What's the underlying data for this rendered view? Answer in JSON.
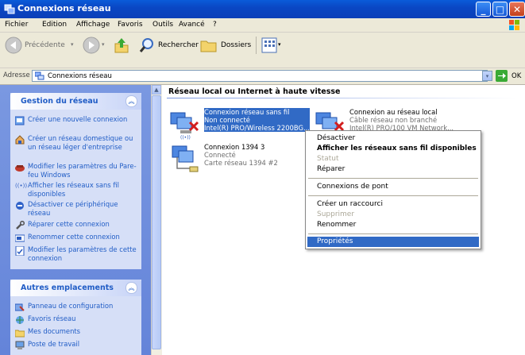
{
  "window": {
    "title": "Connexions réseau"
  },
  "menu": [
    "Fichier",
    "Edition",
    "Affichage",
    "Favoris",
    "Outils",
    "Avancé",
    "?"
  ],
  "toolbar": {
    "back": "Précédente",
    "search": "Rechercher",
    "folders": "Dossiers"
  },
  "address": {
    "label": "Adresse",
    "value": "Connexions réseau",
    "go": "OK"
  },
  "left_panes": [
    {
      "title": "Gestion du réseau",
      "tasks": [
        {
          "icon": "create-connection-icon",
          "label": "Créer une nouvelle connexion"
        },
        {
          "icon": "home-network-icon",
          "label": "Créer un réseau domestique ou un réseau léger d'entreprise"
        },
        {
          "icon": "firewall-icon",
          "label": "Modifier les paramètres du Pare-feu Windows"
        },
        {
          "icon": "wireless-icon",
          "label": "Afficher les réseaux sans fil disponibles"
        },
        {
          "icon": "disable-device-icon",
          "label": "Désactiver ce périphérique réseau"
        },
        {
          "icon": "repair-icon",
          "label": "Réparer cette connexion"
        },
        {
          "icon": "rename-icon",
          "label": "Renommer cette connexion"
        },
        {
          "icon": "properties-icon",
          "label": "Modifier les paramètres de cette connexion"
        }
      ]
    },
    {
      "title": "Autres emplacements",
      "tasks": [
        {
          "icon": "control-panel-icon",
          "label": "Panneau de configuration"
        },
        {
          "icon": "network-places-icon",
          "label": "Favoris réseau"
        },
        {
          "icon": "my-documents-icon",
          "label": "Mes documents"
        },
        {
          "icon": "my-computer-icon",
          "label": "Poste de travail"
        }
      ]
    }
  ],
  "group_header": "Réseau local ou Internet à haute vitesse",
  "connections": [
    {
      "name": "Connexion réseau sans fil",
      "status": "Non connecté",
      "device": "Intel(R) PRO/Wireless 2200BG..."
    },
    {
      "name": "Connexion au réseau local",
      "status": "Câble réseau non branché",
      "device": "Intel(R) PRO/100 VM Network..."
    },
    {
      "name": "Connexion 1394 3",
      "status": "Connecté",
      "device": "Carte réseau 1394 #2"
    }
  ],
  "context_menu": [
    {
      "label": "Désactiver",
      "state": "normal"
    },
    {
      "label": "Afficher les réseaux sans fil disponibles",
      "state": "bold"
    },
    {
      "label": "Statut",
      "state": "disabled"
    },
    {
      "label": "Réparer",
      "state": "normal"
    },
    {
      "label": "Connexions de pont",
      "state": "normal"
    },
    {
      "label": "Créer un raccourci",
      "state": "normal"
    },
    {
      "label": "Supprimer",
      "state": "disabled"
    },
    {
      "label": "Renommer",
      "state": "normal"
    },
    {
      "label": "Propriétés",
      "state": "highlighted"
    }
  ]
}
